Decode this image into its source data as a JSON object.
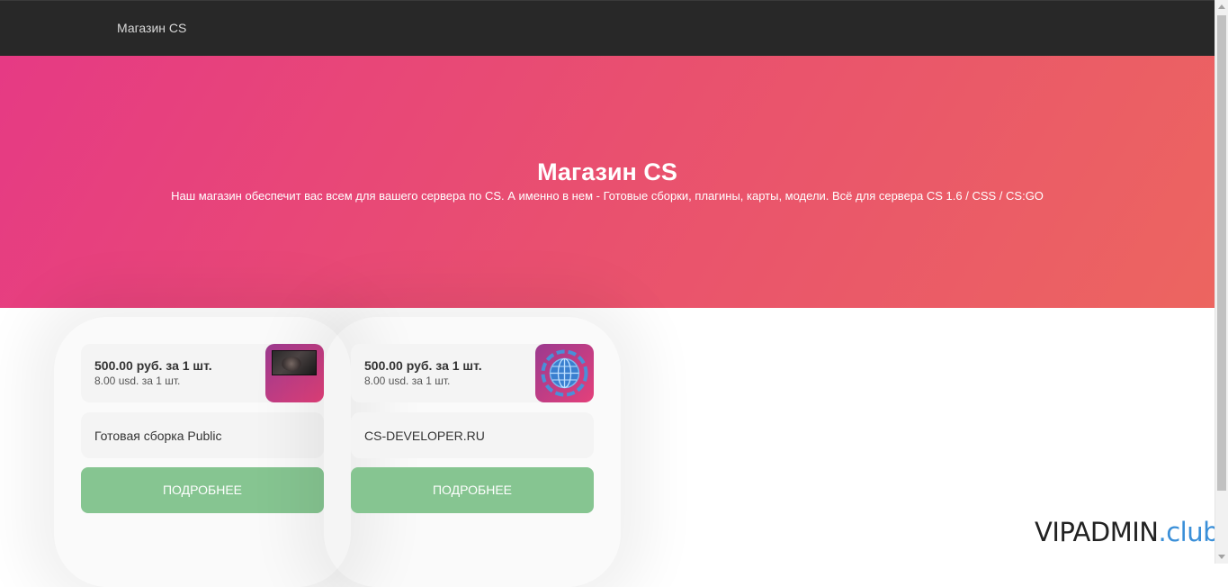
{
  "navbar": {
    "brand": "Магазин CS",
    "background": "#282828"
  },
  "hero": {
    "title": "Магазин CS",
    "subtitle": "Наш магазин обеспечит вас всем для вашего сервера по CS. А именно в нем - Готовые сборки, плагины, карты, модели. Всё для сервера CS 1.6 / CSS / CS:GO",
    "gradient": [
      "#e63a84",
      "#ec6560"
    ]
  },
  "products": [
    {
      "price_rub": "500.00 руб. за 1 шт.",
      "price_usd": "8.00 usd. за 1 шт.",
      "name": "Готовая сборка Public",
      "button": "ПОДРОБНЕЕ",
      "thumb_icon": "game-screenshot-icon"
    },
    {
      "price_rub": "500.00 руб. за 1 шт.",
      "price_usd": "8.00 usd. за 1 шт.",
      "name": "CS-DEVELOPER.RU",
      "button": "ПОДРОБНЕЕ",
      "thumb_icon": "globe-gear-icon"
    }
  ],
  "colors": {
    "button": "#86c591",
    "card_bg": "#f4f4f4",
    "watermark_accent": "#3a8fd8"
  },
  "watermark": {
    "main": "VIPADMIN",
    "suffix": ".club"
  }
}
